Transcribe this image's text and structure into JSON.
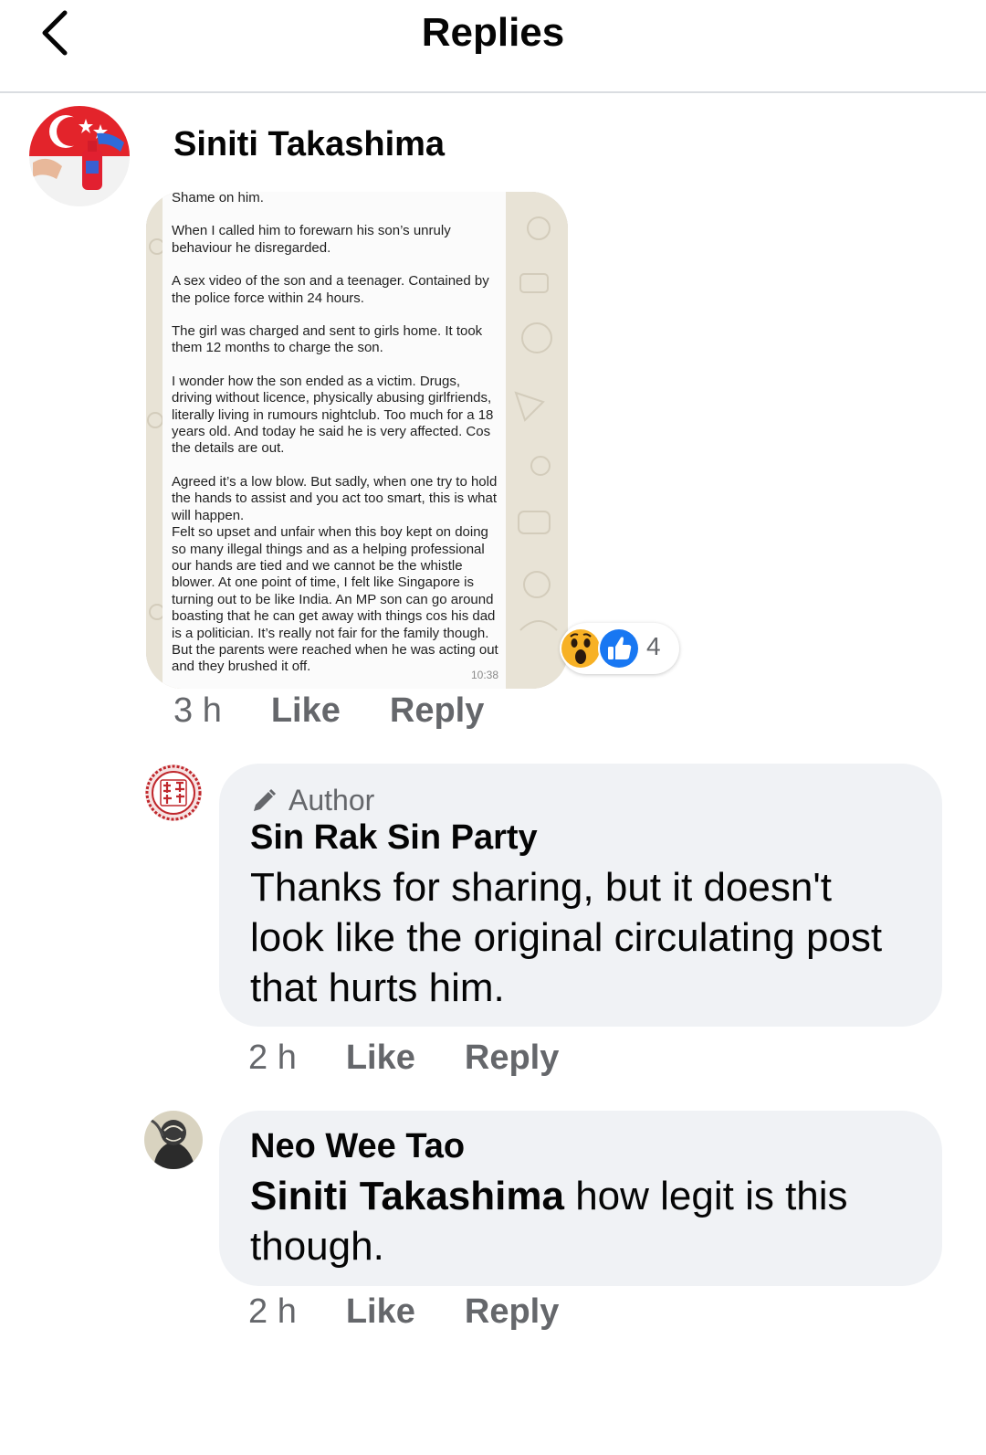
{
  "header": {
    "title": "Replies"
  },
  "parent_comment": {
    "author": "Siniti Takashima",
    "screenshot": {
      "paragraphs": [
        "Shame on him.",
        "When I called him to forewarn his son’s unruly behaviour he disregarded.",
        "A sex video of the son and a teenager. Contained by the police force within 24 hours.",
        "The girl was charged and sent to girls home. It took them 12 months to charge the son.",
        "I wonder how the son ended as a victim. Drugs, driving without licence, physically abusing girlfriends, literally living in rumours nightclub. Too much for a 18 years old. And today he said he is very affected. Cos the details are out.",
        "Agreed it’s a low blow. But sadly, when one try to hold the hands to assist and you act too smart, this is what will happen.",
        "Felt so upset and unfair when this boy kept on doing so many illegal things and as a helping professional our hands are tied and we cannot be the whistle blower. At one point of time, I felt like Singapore is turning out to be like India. An MP son can go around boasting that he can get away with things cos his dad is a politician. It’s really not fair for the family though. But the parents were reached when he was acting out and they brushed it off."
      ],
      "timestamp": "10:38"
    },
    "reactions": {
      "count": "4",
      "icons": [
        "wow-icon",
        "like-icon"
      ]
    },
    "time": "3 h",
    "like_label": "Like",
    "reply_label": "Reply"
  },
  "replies": [
    {
      "badge": "Author",
      "author": "Sin Rak Sin Party",
      "text": "Thanks for sharing, but it doesn't look like the original circulating post that hurts him.",
      "time": "2 h",
      "like_label": "Like",
      "reply_label": "Reply"
    },
    {
      "author": "Neo Wee Tao",
      "mention": "Siniti Takashima",
      "text": " how legit is this though.",
      "time": "2 h",
      "like_label": "Like",
      "reply_label": "Reply"
    }
  ],
  "colors": {
    "bubble_bg": "#f0f2f5",
    "meta_gray": "#65676b",
    "like_blue": "#1877f2",
    "wow_yellow": "#f7b125"
  }
}
